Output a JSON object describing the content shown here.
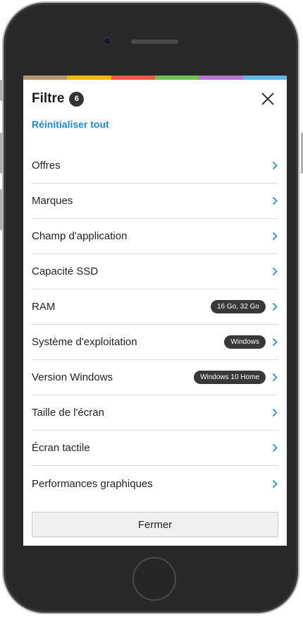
{
  "colors": {
    "strip": [
      "#b49770",
      "#f5b800",
      "#ee5a44",
      "#6dc44f",
      "#b476d0",
      "#5db8e9"
    ],
    "link": "#1b8bd6",
    "chevron": "#1b8bd6",
    "badge_bg": "#333333",
    "pill_bg": "#383838"
  },
  "header": {
    "title": "Filtre",
    "count": "6",
    "close_icon": "close-icon"
  },
  "reset_label": "Réinitialiser tout",
  "filters": [
    {
      "label": "Offres",
      "tag": ""
    },
    {
      "label": "Marques",
      "tag": ""
    },
    {
      "label": "Champ d'application",
      "tag": ""
    },
    {
      "label": "Capacité SSD",
      "tag": ""
    },
    {
      "label": "RAM",
      "tag": "16 Go, 32 Go"
    },
    {
      "label": "Système d'exploitation",
      "tag": "Windows"
    },
    {
      "label": "Version Windows",
      "tag": "Windows 10 Home"
    },
    {
      "label": "Taille de l'écran",
      "tag": ""
    },
    {
      "label": "Écran tactile",
      "tag": ""
    },
    {
      "label": "Performances graphiques",
      "tag": ""
    }
  ],
  "close_button_label": "Fermer"
}
